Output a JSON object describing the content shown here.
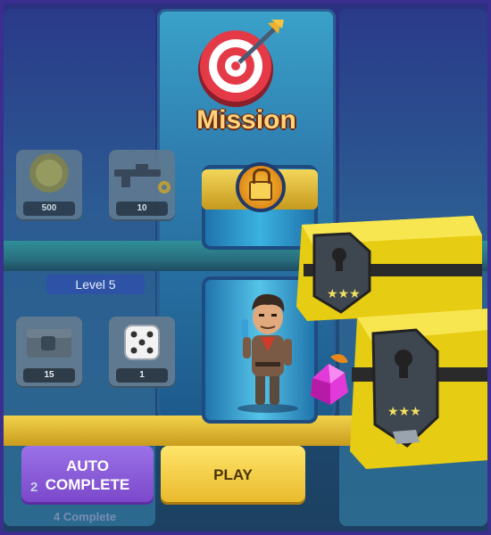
{
  "mission": {
    "title": "Mission"
  },
  "items": [
    {
      "name": "coin",
      "count": "500"
    },
    {
      "name": "rifle",
      "count": "10"
    },
    {
      "name": "loot-crate",
      "count": "15"
    },
    {
      "name": "dice",
      "count": "1"
    }
  ],
  "level": {
    "label": "Level 5"
  },
  "buttons": {
    "auto_line1": "AUTO",
    "auto_line2": "COMPLETE",
    "auto_count": "2",
    "play": "PLAY"
  },
  "footer": {
    "text": "4 Complete"
  },
  "chests": [
    {
      "stars": 3
    },
    {
      "stars": 3
    }
  ],
  "colors": {
    "accent_gold": "#f3d65a",
    "purple_button": "#8a5ad8",
    "play_button": "#f2c93a"
  }
}
